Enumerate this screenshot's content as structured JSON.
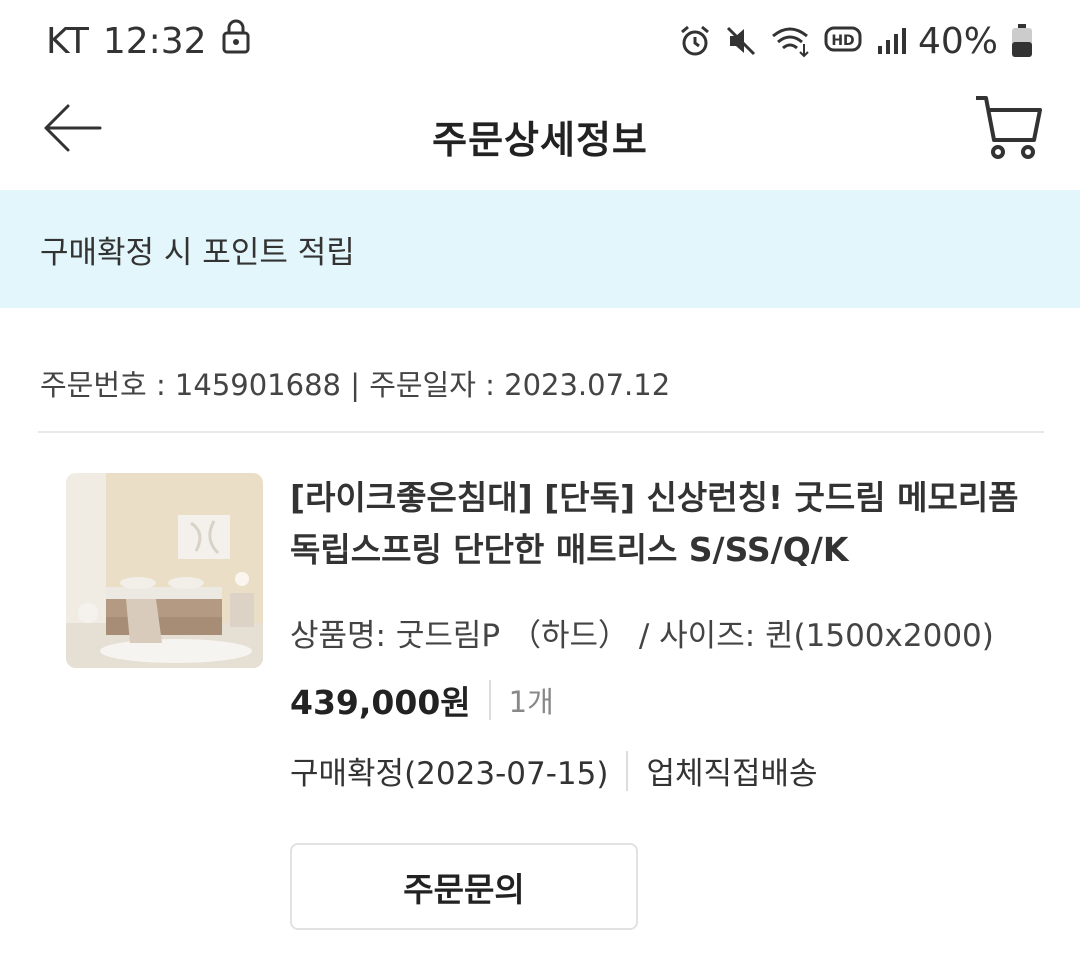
{
  "status_bar": {
    "carrier": "KT",
    "time": "12:32",
    "battery": "40%",
    "battery_level": 0.4
  },
  "header": {
    "title": "주문상세정보"
  },
  "notice": {
    "text": "구매확정 시 포인트 적립"
  },
  "order": {
    "meta": "주문번호 : 145901688 | 주문일자 : 2023.07.12"
  },
  "product": {
    "title": "[라이크좋은침대] [단독] 신상런칭! 굿드림 메모리폼 독립스프링 단단한 매트리스 S/SS/Q/K",
    "option": "상품명: 굿드림P （하드） / 사이즈: 퀸(1500x2000)",
    "price": "439,000원",
    "quantity": "1개",
    "status": "구매확정(2023-07-15)",
    "delivery": "업체직접배송"
  },
  "actions": {
    "inquiry_label": "주문문의"
  },
  "colors": {
    "notice_bg": "#e3f6fb",
    "text_primary": "#222222"
  }
}
